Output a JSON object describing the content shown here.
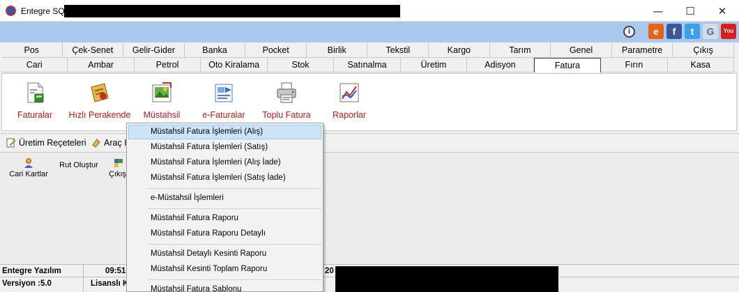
{
  "window": {
    "title": "Entegre SQL",
    "minimize": "—",
    "maximize": "☐",
    "close": "✕"
  },
  "social": [
    {
      "name": "explorer-icon",
      "glyph": "e",
      "color": "#e8601c"
    },
    {
      "name": "facebook-icon",
      "glyph": "f",
      "color": "#3b5998"
    },
    {
      "name": "twitter-icon",
      "glyph": "t",
      "color": "#3aa0e8"
    },
    {
      "name": "google-icon",
      "glyph": "G",
      "color": "#dadada"
    },
    {
      "name": "youtube-icon",
      "glyph": "You",
      "color": "#d62020"
    }
  ],
  "tabs_row1": [
    "Pos",
    "Çek-Senet",
    "Gelir-Gider",
    "Banka",
    "Pocket",
    "Birlik",
    "Tekstil",
    "Kargo",
    "Tarım",
    "Genel",
    "Parametre",
    "Çıkış"
  ],
  "tabs_row2": [
    "Cari",
    "Ambar",
    "Petrol",
    "Oto Kiralama",
    "Stok",
    "Satınalma",
    "Üretim",
    "Adisyon",
    "Fatura",
    "Fırın",
    "Kasa"
  ],
  "active_tab": "Fatura",
  "toolbar": {
    "faturalar": "Faturalar",
    "hizli_perakende": "Hızlı Perakende",
    "mustahsil": "Müstahsil",
    "e_faturalar": "e-Faturalar",
    "toplu_fatura": "Toplu Fatura",
    "raporlar": "Raporlar"
  },
  "band": {
    "uretim_receteleri": "Üretim Reçeteleri",
    "arac": "Araç I"
  },
  "shortcuts": {
    "cari_kartlar": "Cari Kartlar",
    "rut_olustur": "Rut Oluştur",
    "cikis": "Çıkış"
  },
  "menu": {
    "alis": "Müstahsil Fatura İşlemleri (Alış)",
    "satis": "Müstahsil Fatura İşlemleri (Satış)",
    "alis_iade": "Müstahsil Fatura İşlemleri (Alış İade)",
    "satis_iade": "Müstahsil Fatura İşlemleri (Satış İade)",
    "e_mustahsil": "e-Müstahsil İşlemleri",
    "rapor": "Müstahsil Fatura Raporu",
    "rapor_detayli": "Müstahsil Fatura Raporu Detaylı",
    "kesinti_detayli": "Müstahsil Detaylı Kesinti Raporu",
    "kesinti_toplam": "Müstahsil Kesinti Toplam Raporu",
    "sablonu": "Müstahsil Fatura Şablonu"
  },
  "status": {
    "company": "Entegre Yazılım",
    "time": "09:51",
    "year_fragment": "20",
    "version": "Versiyon :5.0",
    "license": "Lisanslı K"
  }
}
